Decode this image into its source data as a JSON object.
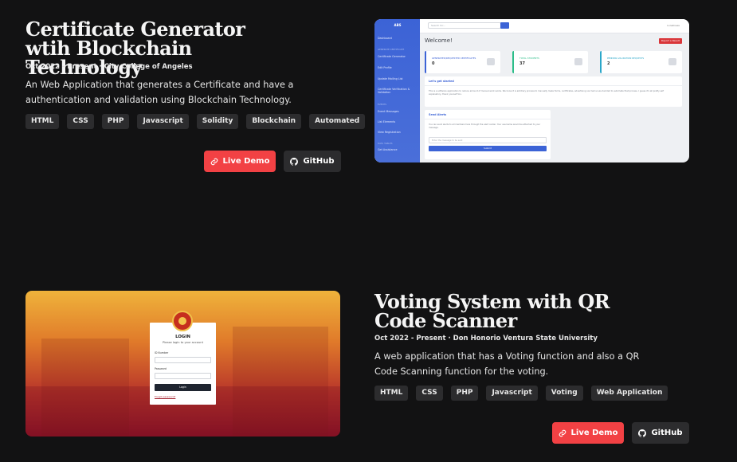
{
  "projects": [
    {
      "title": "Certificate Generator wtih Blockchain Technology",
      "meta": "Oct 2022 - Present · City College of Angeles",
      "description": "An Web Application that generates a Certificate and have a authentication and validation using Blockchain Technology.",
      "tags": [
        "HTML",
        "CSS",
        "PHP",
        "Javascript",
        "Solidity",
        "Blockchain",
        "Automated"
      ],
      "live_label": "Live Demo",
      "github_label": "GitHub"
    },
    {
      "title": "Voting System with QR Code Scanner",
      "meta": "Oct 2022 - Present · Don Honorio Ventura State University",
      "description": "A web application that has a Voting function and also a QR Code Scanning function for the voting.",
      "tags": [
        "HTML",
        "CSS",
        "PHP",
        "Javascript",
        "Voting",
        "Web Application"
      ],
      "live_label": "Live Demo",
      "github_label": "GitHub"
    }
  ],
  "dashboard": {
    "logo": "ABS",
    "search_placeholder": "Search for...",
    "user": "Loneliness",
    "sidebar": {
      "items": [
        "Dashboard",
        "Certificate Generator",
        "Edit Profile",
        "Update Mailing List",
        "Certificate Verification & Validation",
        "Event Messages",
        "List Elements",
        "View Registration",
        "Get Assistance"
      ],
      "sections": [
        "GENERATE CERTIFICATE",
        "EVENTS",
        "DATA TABLES"
      ]
    },
    "welcome": "Welcome!",
    "report_button": "Report a Result",
    "cards": [
      {
        "label": "GENERATED/REQUESTED CERTIFICATES",
        "value": "0"
      },
      {
        "label": "TOTAL STUDENTS",
        "value": "37"
      },
      {
        "label": "PENDING VALIDATION REQUESTS",
        "value": "2"
      }
    ],
    "started_title": "Let's get started",
    "started_text": "This is a software application to reduce amount of manual work works. We know it is arbitrary process to manually make forms, certificates, advertising via mail so we decided to automate that process. I guess it's all pretty self explanatory, thank yourself too.",
    "alerts_title": "Send Alerts",
    "alerts_text": "You can send alerts to all members here through the alert center. Your username would be attached to your message.",
    "alerts_placeholder": "Enter the message to be sent",
    "alerts_submit": "Submit"
  },
  "login": {
    "title": "LOGIN",
    "subtitle": "Please login to your account",
    "id_label": "ID Number",
    "password_label": "Password",
    "button": "Login",
    "forgot": "Forgot password?"
  },
  "colors": {
    "background": "#121213",
    "accent_red": "#f24144",
    "button_dark": "#2c2c2e",
    "tag_bg": "#2c2c2e"
  },
  "icons": {
    "live": "link-icon",
    "github": "github-icon"
  }
}
